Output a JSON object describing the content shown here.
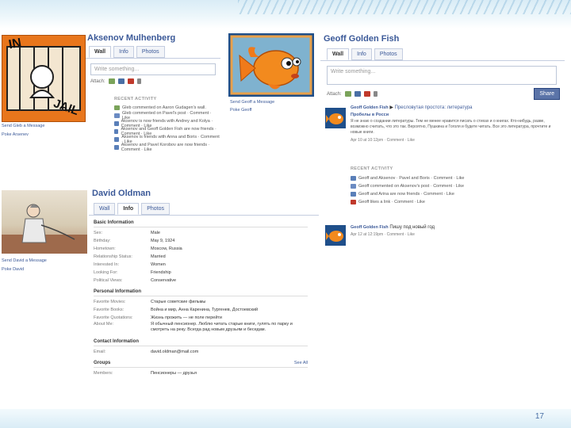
{
  "slide": {
    "page_number": "17"
  },
  "profile1": {
    "name": "Aksenov Mulhenberg",
    "tabs": [
      "Wall",
      "Info",
      "Photos"
    ],
    "placeholder": "Write something...",
    "attach_label": "Attach:",
    "photo_lines": [
      "Send Gleb a Message",
      "Poke Arsenev"
    ],
    "photo_text": [
      "IN",
      "JAIL"
    ],
    "recent_activity_title": "RECENT ACTIVITY",
    "activity": [
      "Gleb commented on Aaron Gudagen's wall.",
      "Gleb commented on Pavel's post · Comment · Like",
      "Aksenov is now friends with Andrey and Kolya · Comment · Like",
      "Aksenov and Geoff Golden Fish are now friends · Comment · Like",
      "Aksenov is friends with Anna and Boris · Comment · Like",
      "Aksenov and Pavel Korobov are now friends · Comment · Like"
    ]
  },
  "fish_photo": {
    "lines": [
      "Send Geoff a Message",
      "Poke Geoff"
    ]
  },
  "profile2": {
    "name": "Geoff Golden Fish",
    "tabs": [
      "Wall",
      "Info",
      "Photos"
    ],
    "placeholder": "Write something...",
    "attach_label": "Attach:",
    "share_label": "Share",
    "post1": {
      "author": "Geoff Golden Fish",
      "title": "Пресловутая простота: литература",
      "subtitle": "Пробелы в Росси",
      "body": "Я не знаю о создании литературы. Тем не менее нравится писать о стихах и о книгах. Кто-нибудь, разве, возможно считать, что это так. Вероятно, Пушкина и Гоголя и будете читать. Все это литература, прочтите и новые книги.",
      "meta": "Apr 10 at 10:12pm · Comment · Like"
    },
    "recent_title": "RECENT ACTIVITY",
    "recent": [
      "Geoff and Aksenov · Pavel and Boris · Comment · Like",
      "Geoff commented on Aksenov's post · Comment · Like",
      "Geoff and Arina are now friends · Comment · Like",
      "Geoff likes a link · Comment · Like"
    ],
    "post2": {
      "author": "Geoff Golden Fish",
      "title": "Пишу под новый год",
      "meta": "Apr 12 at 12:19pm · Comment · Like"
    }
  },
  "profile3": {
    "name": "David Oldman",
    "tabs": [
      "Wall",
      "Info",
      "Photos"
    ],
    "photo_lines": [
      "Send David a Message",
      "Poke David"
    ],
    "basic_title": "Basic Information",
    "basic": [
      {
        "k": "Sex:",
        "v": "Male"
      },
      {
        "k": "Birthday:",
        "v": "May 9, 1924"
      },
      {
        "k": "Hometown:",
        "v": "Moscow, Russia"
      },
      {
        "k": "Relationship Status:",
        "v": "Married"
      },
      {
        "k": "Interested In:",
        "v": "Women"
      },
      {
        "k": "Looking For:",
        "v": "Friendship"
      },
      {
        "k": "Political Views:",
        "v": "Conservative"
      }
    ],
    "personal_title": "Personal Information",
    "personal": [
      {
        "k": "Favorite Movies:",
        "v": "Старые советские фильмы"
      },
      {
        "k": "Favorite Books:",
        "v": "Война и мир, Анна Каренина, Тургенев, Достоевский"
      },
      {
        "k": "Favorite Quotations:",
        "v": "Жизнь прожить — не поле перейти"
      }
    ],
    "about_label": "About Me:",
    "about": "Я обычный пенсионер. Люблю читать старые книги, гулять по парку и смотреть на реку. Всегда рад новым друзьям и беседам.",
    "contact_title": "Contact Information",
    "contact": [
      {
        "k": "Email:",
        "v": "david.oldman@mail.com"
      }
    ],
    "groups_title": "Groups",
    "groups_link": "See All",
    "groups": [
      {
        "k": "Members:",
        "v": "Пенсионеры — друзья"
      }
    ]
  },
  "colors": {
    "fb_blue": "#3b5998",
    "orange": "#e8731a"
  }
}
